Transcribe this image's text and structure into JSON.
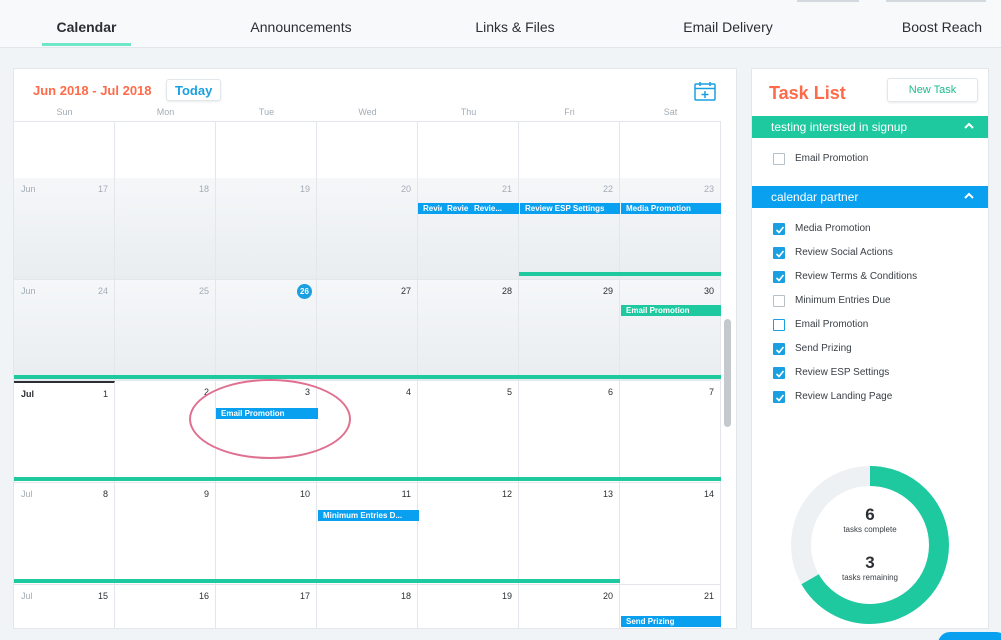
{
  "nav": {
    "tabs": [
      {
        "label": "Calendar",
        "active": true
      },
      {
        "label": "Announcements"
      },
      {
        "label": "Links & Files"
      },
      {
        "label": "Email Delivery"
      },
      {
        "label": "Boost Reach"
      }
    ]
  },
  "calendar": {
    "range": "Jun 2018 - Jul 2018",
    "today_label": "Today",
    "weekdays": [
      "Sun",
      "Mon",
      "Tue",
      "Wed",
      "Thu",
      "Fri",
      "Sat"
    ],
    "weeks": [
      {
        "month": "",
        "days": [
          "",
          "",
          "",
          "",
          "",
          "",
          ""
        ]
      },
      {
        "month": "Jun",
        "days": [
          "17",
          "18",
          "19",
          "20",
          "21",
          "22",
          "23"
        ]
      },
      {
        "month": "Jun",
        "days": [
          "24",
          "25",
          "26",
          "27",
          "28",
          "29",
          "30"
        ]
      },
      {
        "month": "Jul",
        "days": [
          "1",
          "2",
          "3",
          "4",
          "5",
          "6",
          "7"
        ]
      },
      {
        "month": "Jul",
        "days": [
          "8",
          "9",
          "10",
          "11",
          "12",
          "13",
          "14"
        ]
      },
      {
        "month": "Jul",
        "days": [
          "15",
          "16",
          "17",
          "18",
          "19",
          "20",
          "21"
        ]
      }
    ],
    "events": {
      "rev1": "Revie",
      "rev2": "Revie",
      "rev3": "Revie...",
      "review_esp": "Review ESP Settings",
      "media_promo": "Media Promotion",
      "email_promo_30": "Email Promotion",
      "email_promo_3": "Email Promotion",
      "min_entries": "Minimum Entries D...",
      "send_prizing": "Send Prizing"
    },
    "colors": {
      "event_blue": "#0aa0f0",
      "event_teal": "#1fc9a0",
      "today": "#1a9fe0"
    }
  },
  "tasks": {
    "title": "Task List",
    "new_task_label": "New Task",
    "groups": [
      {
        "name": "testing intersted in signup",
        "items": [
          {
            "label": "Email Promotion",
            "checked": false
          }
        ]
      },
      {
        "name": "calendar partner",
        "items": [
          {
            "label": "Media Promotion",
            "checked": true
          },
          {
            "label": "Review Social Actions",
            "checked": true
          },
          {
            "label": "Review Terms & Conditions",
            "checked": true
          },
          {
            "label": "Minimum Entries Due",
            "checked": false
          },
          {
            "label": "Email Promotion",
            "checked": false
          },
          {
            "label": "Send Prizing",
            "checked": true
          },
          {
            "label": "Review ESP Settings",
            "checked": true
          },
          {
            "label": "Review Landing Page",
            "checked": true
          }
        ]
      }
    ],
    "summary": {
      "complete_count": "6",
      "complete_label": "tasks complete",
      "remaining_count": "3",
      "remaining_label": "tasks remaining",
      "complete_fraction": 0.667
    }
  }
}
